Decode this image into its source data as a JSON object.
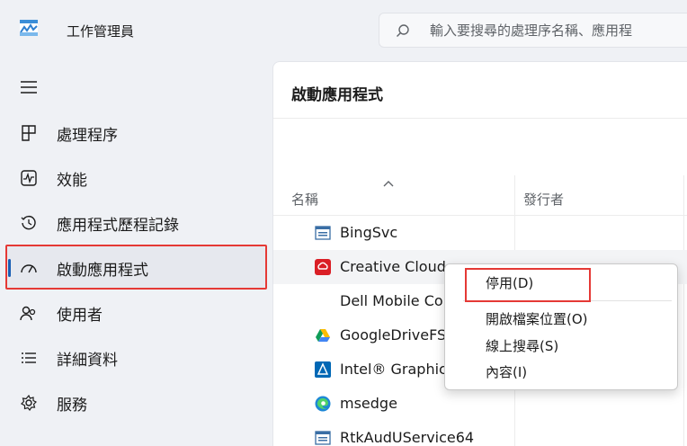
{
  "window": {
    "title": "工作管理員",
    "search_placeholder": "輸入要搜尋的處理序名稱、應用程"
  },
  "sidebar": {
    "items": [
      {
        "label": "處理程序",
        "icon": "processes-icon"
      },
      {
        "label": "效能",
        "icon": "performance-icon"
      },
      {
        "label": "應用程式歷程記錄",
        "icon": "app-history-icon"
      },
      {
        "label": "啟動應用程式",
        "icon": "startup-apps-icon",
        "active": true
      },
      {
        "label": "使用者",
        "icon": "users-icon"
      },
      {
        "label": "詳細資料",
        "icon": "details-icon"
      },
      {
        "label": "服務",
        "icon": "services-icon"
      }
    ]
  },
  "main": {
    "title": "啟動應用程式",
    "columns": [
      "名稱",
      "發行者"
    ],
    "rows": [
      {
        "name": "BingSvc",
        "icon": "window-app-icon"
      },
      {
        "name": "Creative Cloud",
        "icon": "creative-cloud-icon"
      },
      {
        "name": "Dell Mobile Co",
        "icon": ""
      },
      {
        "name": "GoogleDriveFS",
        "icon": "google-drive-icon"
      },
      {
        "name": "Intel® Graphic",
        "icon": "intel-graphics-icon"
      },
      {
        "name": "msedge",
        "icon": "edge-icon"
      },
      {
        "name": "RtkAudUService64",
        "icon": "window-app-icon"
      }
    ]
  },
  "context_menu": {
    "items": [
      "停用(D)",
      "開啟檔案位置(O)",
      "線上搜尋(S)",
      "內容(I)"
    ]
  },
  "colors": {
    "accent": "#1a5fb4",
    "highlight_border": "#e53935",
    "background": "#eff1f5",
    "panel": "#ffffff"
  }
}
